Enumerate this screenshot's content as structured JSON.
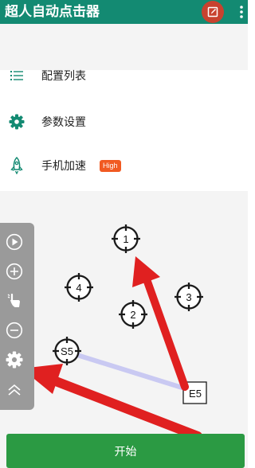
{
  "app": {
    "title": "超人自动点击器"
  },
  "toolbar": {
    "edit_icon": "edit-icon",
    "more_icon": "more-vertical-icon"
  },
  "menu": {
    "items": [
      {
        "label": "配置列表",
        "icon": "list-icon"
      },
      {
        "label": "参数设置",
        "icon": "gear-icon"
      },
      {
        "label": "手机加速",
        "icon": "rocket-icon",
        "badge": "High"
      }
    ]
  },
  "floating_toolbar": {
    "buttons": [
      "play-icon",
      "add-icon",
      "tap-gesture-icon",
      "remove-icon",
      "gear-icon",
      "collapse-up-icon"
    ]
  },
  "click_targets": [
    "1",
    "2",
    "3",
    "4"
  ],
  "swipe": {
    "start_label": "S5",
    "end_label": "E5"
  },
  "start_button": {
    "label": "开始"
  },
  "colors": {
    "primary": "#138a72",
    "accent": "#c8422f",
    "badge": "#f15a22",
    "start": "#2b9a43",
    "arrow": "#e02020",
    "swipe_line": "#c9c9f2"
  }
}
